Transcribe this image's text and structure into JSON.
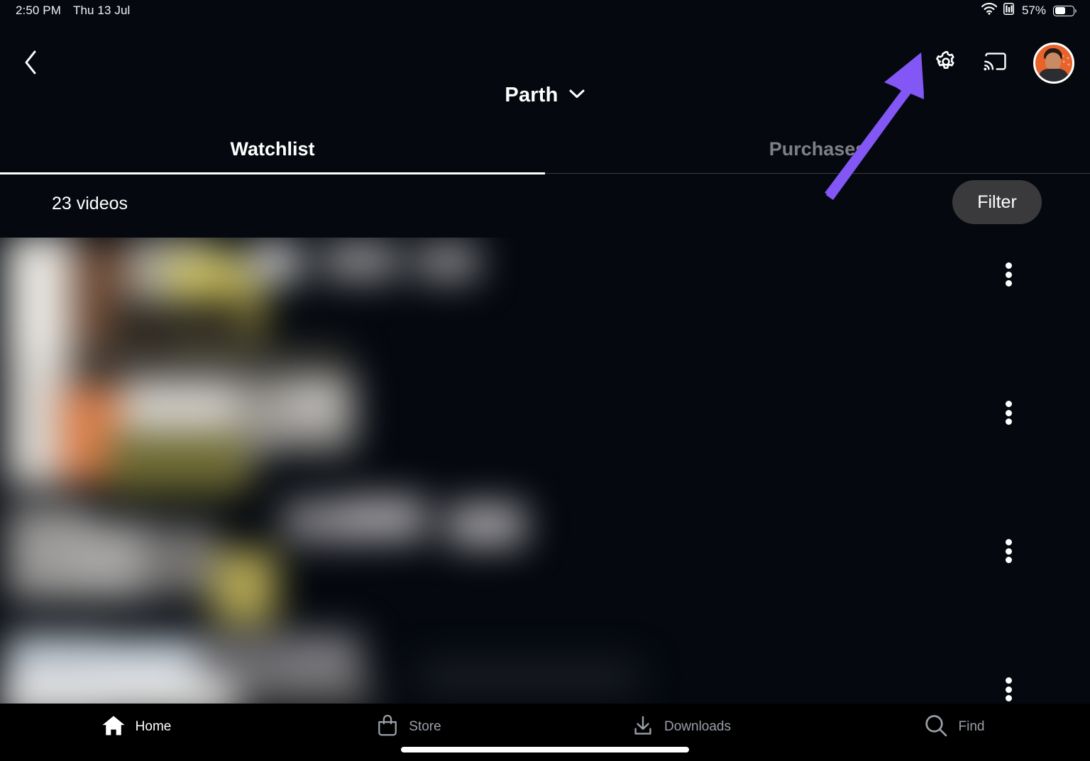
{
  "statusbar": {
    "time": "2:50 PM",
    "date": "Thu 13 Jul",
    "battery_percent": "57%",
    "wifi_icon": "wifi-icon",
    "cellular_icon": "signal-bars-icon",
    "battery_icon": "battery-icon"
  },
  "header": {
    "back_icon": "chevron-left-icon",
    "settings_icon": "gear-icon",
    "cast_icon": "cast-icon",
    "avatar_icon": "profile-avatar"
  },
  "profile": {
    "name": "Parth",
    "chevron_icon": "chevron-down-icon"
  },
  "tabs": [
    {
      "label": "Watchlist",
      "active": true
    },
    {
      "label": "Purchases",
      "active": false
    }
  ],
  "list_header": {
    "count_label": "23 videos",
    "filter_label": "Filter"
  },
  "content": {
    "rows": [
      {
        "menu_icon": "overflow-menu-icon"
      },
      {
        "menu_icon": "overflow-menu-icon"
      },
      {
        "menu_icon": "overflow-menu-icon"
      },
      {
        "menu_icon": "overflow-menu-icon"
      }
    ],
    "note": "video list thumbnails and titles are blurred"
  },
  "annotation": {
    "type": "arrow",
    "points_to": "gear-icon",
    "color": "#8257f5"
  },
  "bottom_nav": [
    {
      "label": "Home",
      "icon": "home-icon",
      "active": true
    },
    {
      "label": "Store",
      "icon": "shopping-bag-icon",
      "active": false
    },
    {
      "label": "Downloads",
      "icon": "download-icon",
      "active": false
    },
    {
      "label": "Find",
      "icon": "search-icon",
      "active": false
    }
  ],
  "colors": {
    "background": "#05090f",
    "nav_background": "#000000",
    "accent_purple": "#8257f5",
    "filter_pill": "#3a3a3c",
    "inactive_text": "#7e8086",
    "avatar_bg": "#e8622a"
  }
}
